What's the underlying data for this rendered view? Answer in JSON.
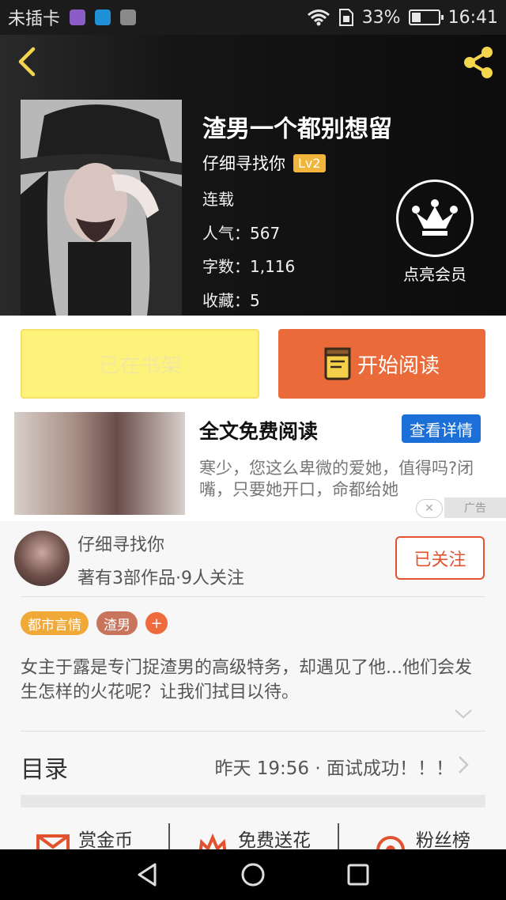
{
  "status_bar": {
    "carrier": "未插卡",
    "battery_percent_text": "33%",
    "battery_level": 0.33,
    "time": "16:41"
  },
  "book": {
    "title": "渣男一个都别想留",
    "author": "仔细寻找你",
    "author_level": "Lv2",
    "status": "连载",
    "popularity": "人气：567",
    "word_count": "字数：1,116",
    "favorites": "收藏：5"
  },
  "vip": {
    "label": "点亮会员"
  },
  "actions": {
    "shelf_label": "已在书架",
    "read_label": "开始阅读"
  },
  "ad": {
    "title": "全文免费阅读",
    "button": "查看详情",
    "description": "寒少，您这么卑微的爱她，值得吗?闭嘴，只要她开口，命都给她",
    "tag": "广告"
  },
  "author_card": {
    "name": "仔细寻找你",
    "stats": "著有3部作品·9人关注",
    "follow_label": "已关注"
  },
  "tags": [
    {
      "label": "都市言情",
      "color": "#f0a937"
    },
    {
      "label": "渣男",
      "color": "#c9745d"
    },
    {
      "label": "+",
      "color": "#ef6a3c"
    }
  ],
  "synopsis": "女主于露是专门捉渣男的高级特务，却遇见了他...他们会发生怎样的火花呢？让我们拭目以待。",
  "toc": {
    "label": "目录",
    "latest": "昨天 19:56 · 面试成功！！！"
  },
  "bottom_tabs": [
    {
      "label": "赏金币",
      "icon": "envelope-icon"
    },
    {
      "label": "免费送花",
      "icon": "flower-icon"
    },
    {
      "label": "粉丝榜",
      "icon": "target-icon"
    }
  ],
  "colors": {
    "accent_orange": "#ea6a39",
    "shelf_yellow": "#fef37a",
    "lv_badge": "#f1b53c",
    "ad_button_blue": "#1b6fd6",
    "follow_red": "#e2522f",
    "share_icon_yellow": "#f4d64e"
  }
}
